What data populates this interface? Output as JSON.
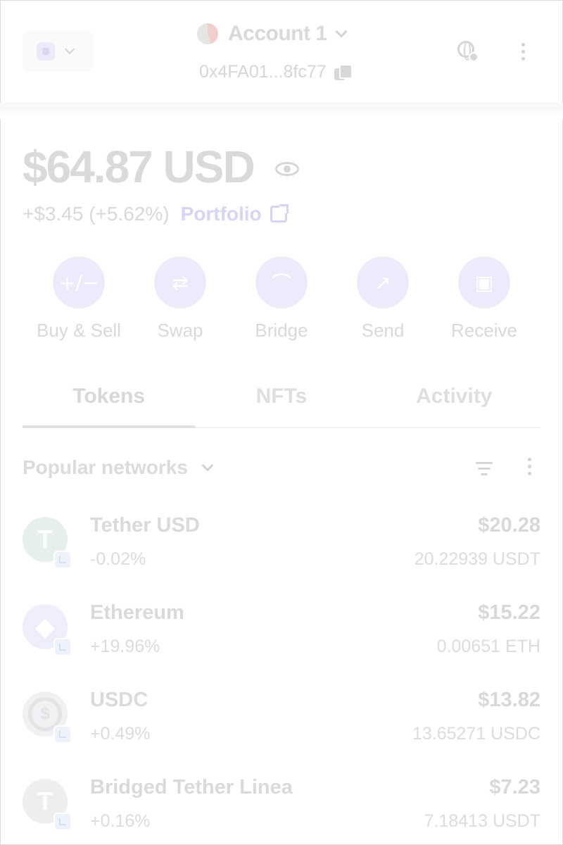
{
  "header": {
    "account_name": "Account 1",
    "address": "0x4FA01...8fc77"
  },
  "balance": {
    "amount": "$64.87 USD",
    "change": "+$3.45 (+5.62%)",
    "portfolio_label": "Portfolio"
  },
  "actions": [
    {
      "label": "Buy & Sell",
      "icon": "buy-sell-icon",
      "glyph": "+∕−"
    },
    {
      "label": "Swap",
      "icon": "swap-icon",
      "glyph": "⇄"
    },
    {
      "label": "Bridge",
      "icon": "bridge-icon",
      "glyph": "⌒"
    },
    {
      "label": "Send",
      "icon": "send-arrow-icon",
      "glyph": "↗"
    },
    {
      "label": "Receive",
      "icon": "qr-code-icon",
      "glyph": "▣"
    }
  ],
  "tabs": [
    {
      "label": "Tokens",
      "active": true
    },
    {
      "label": "NFTs",
      "active": false
    },
    {
      "label": "Activity",
      "active": false
    }
  ],
  "filter": {
    "label": "Popular networks"
  },
  "tokens": [
    {
      "name": "Tether USD",
      "change": "-0.02%",
      "fiat": "$20.28",
      "amount": "20.22939 USDT",
      "logo": "usdt"
    },
    {
      "name": "Ethereum",
      "change": "+19.96%",
      "fiat": "$15.22",
      "amount": "0.00651 ETH",
      "logo": "eth"
    },
    {
      "name": "USDC",
      "change": "+0.49%",
      "fiat": "$13.82",
      "amount": "13.65271 USDC",
      "logo": "usdc"
    },
    {
      "name": "Bridged Tether Linea",
      "change": "+0.16%",
      "fiat": "$7.23",
      "amount": "7.18413 USDT",
      "logo": "usdt"
    }
  ],
  "colors": {
    "accent": "#ecebfb",
    "link": "#d6d5f5",
    "text": "#d9d9dc"
  }
}
